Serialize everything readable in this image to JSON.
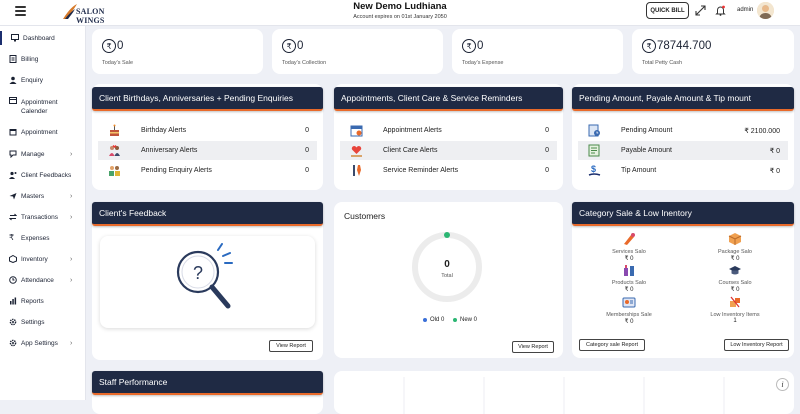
{
  "header": {
    "logo_text": "SALON WINGS",
    "title": "New Demo Ludhiana",
    "subtitle": "Account expires on 01st January 2050",
    "quick_bill": "QUICK BILL",
    "user": "admin"
  },
  "sidebar": {
    "items": [
      {
        "label": "Dashboard",
        "icon": "monitor-icon",
        "arrow": false,
        "active": true
      },
      {
        "label": "Billing",
        "icon": "billing-icon",
        "arrow": false
      },
      {
        "label": "Enquiry",
        "icon": "enquiry-icon",
        "arrow": false
      },
      {
        "label": "Appointment Calender",
        "icon": "calendar-icon",
        "arrow": false
      },
      {
        "label": "Appointment",
        "icon": "appointment-icon",
        "arrow": false
      },
      {
        "label": "Manage",
        "icon": "manage-icon",
        "arrow": true
      },
      {
        "label": "Client Feedbacks",
        "icon": "feedback-icon",
        "arrow": false
      },
      {
        "label": "Masters",
        "icon": "masters-icon",
        "arrow": true
      },
      {
        "label": "Transactions",
        "icon": "transactions-icon",
        "arrow": true
      },
      {
        "label": "Expenses",
        "icon": "rupee-icon",
        "arrow": false
      },
      {
        "label": "Inventory",
        "icon": "inventory-icon",
        "arrow": true
      },
      {
        "label": "Attendance",
        "icon": "attendance-icon",
        "arrow": true
      },
      {
        "label": "Reports",
        "icon": "reports-icon",
        "arrow": false
      },
      {
        "label": "Settings",
        "icon": "settings-icon",
        "arrow": false
      },
      {
        "label": "App Settings",
        "icon": "app-settings-icon",
        "arrow": true
      }
    ]
  },
  "stats": [
    {
      "value": "0",
      "label": "Today's Sale"
    },
    {
      "value": "0",
      "label": "Today's Collection"
    },
    {
      "value": "0",
      "label": "Today's Expense"
    },
    {
      "value": "78744.700",
      "label": "Total Petty Cash"
    }
  ],
  "birthdays": {
    "title": "Client Birthdays, Anniversaries + Pending Enquiries",
    "rows": [
      {
        "label": "Birthday Alerts",
        "value": "0"
      },
      {
        "label": "Anniversary Alerts",
        "value": "0"
      },
      {
        "label": "Pending Enquiry Alerts",
        "value": "0"
      }
    ]
  },
  "appointments": {
    "title": "Appointments, Client Care & Service Reminders",
    "rows": [
      {
        "label": "Appointment Alerts",
        "value": "0"
      },
      {
        "label": "Client Care Alerts",
        "value": "0"
      },
      {
        "label": "Service Reminder Alerts",
        "value": "0"
      }
    ]
  },
  "pending": {
    "title": "Pending Amount, Payale Amount & Tip mount",
    "rows": [
      {
        "label": "Pending Amount",
        "value": "₹ 2100.000"
      },
      {
        "label": "Payable Amount",
        "value": "₹ 0"
      },
      {
        "label": "Tip Amount",
        "value": "₹ 0"
      }
    ]
  },
  "feedback": {
    "title": "Client's Feedback",
    "button": "View Report"
  },
  "customers": {
    "title": "Customers",
    "total": "0",
    "total_label": "Total",
    "legend_old": "Old 0",
    "legend_new": "New 0",
    "button": "View Report",
    "colors": {
      "old": "#3b6fd8",
      "new": "#2bb673",
      "ring": "#ececec"
    }
  },
  "category": {
    "title": "Category Sale & Low Inentory",
    "items": [
      {
        "label": "Services Salo",
        "value": "₹ 0",
        "icon": "services-icon"
      },
      {
        "label": "Package Salo",
        "value": "₹ 0",
        "icon": "package-icon"
      },
      {
        "label": "Products Salo",
        "value": "₹ 0",
        "icon": "products-icon"
      },
      {
        "label": "Courses Salo",
        "value": "₹ 0",
        "icon": "courses-icon"
      },
      {
        "label": "Memberships Sale",
        "value": "₹ 0",
        "icon": "membership-icon"
      },
      {
        "label": "Low Inventory Items",
        "value": "1",
        "icon": "low-inventory-icon"
      }
    ],
    "button_left": "Category sale Report",
    "button_right": "Low Inventory Report"
  },
  "staff": {
    "title": "Staff Performance"
  }
}
